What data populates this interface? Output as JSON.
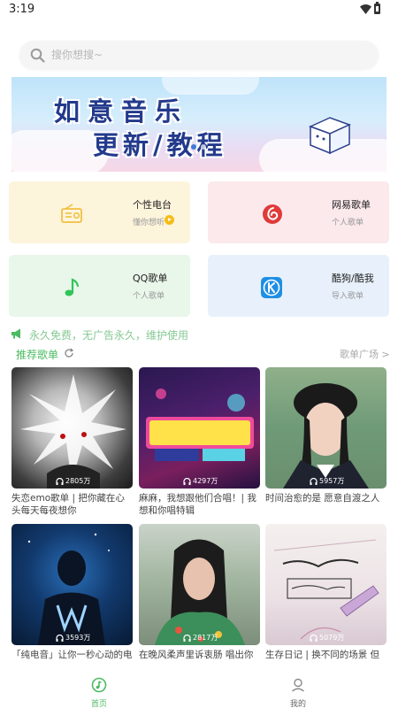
{
  "status_bar": {
    "time": "3:19"
  },
  "search": {
    "placeholder": "搜你想搜~"
  },
  "banner": {
    "line1": "如意音乐",
    "line2": "更新/教程"
  },
  "quick_cards": [
    {
      "title": "个性电台",
      "subtitle": "懂你想听",
      "bg": "#fdf4dc",
      "icon": "radio-icon",
      "color": "#f0c040"
    },
    {
      "title": "网易歌单",
      "subtitle": "个人歌单",
      "bg": "#fbe9ec",
      "icon": "netease-icon",
      "color": "#e03a3a"
    },
    {
      "title": "QQ歌单",
      "subtitle": "个人歌单",
      "bg": "#e9f6ea",
      "icon": "qq-music-icon",
      "color": "#31c45a"
    },
    {
      "title": "酷狗/酷我",
      "subtitle": "导入歌单",
      "bg": "#e8f1fb",
      "icon": "kugou-icon",
      "color": "#1f8fe5"
    }
  ],
  "notice": {
    "text": "永久免费，无广告永久，维护使用"
  },
  "section": {
    "title": "推荐歌单",
    "more": "歌单广场 >"
  },
  "playlists": [
    {
      "title": "失恋emo歌单 | 把你藏在心头每天每夜想你",
      "plays": "2805万"
    },
    {
      "title": "麻麻，我想跟他们合唱！| 我想和你唱特辑",
      "plays": "4297万"
    },
    {
      "title": "时间治愈的是 愿意自渡之人",
      "plays": "5957万"
    },
    {
      "title": "「纯电音」让你一秒心动的电",
      "plays": "3593万"
    },
    {
      "title": "在晚风柔声里诉衷肠 唱出你的不",
      "plays": "2817万"
    },
    {
      "title": "生存日记 | 换不同的场景 但重",
      "plays": "5079万"
    }
  ],
  "bottom_nav": {
    "items": [
      {
        "label": "首页",
        "icon": "music-disc-icon",
        "active": true
      },
      {
        "label": "我的",
        "icon": "profile-icon",
        "active": false
      }
    ],
    "active_color": "#4cbb62"
  }
}
